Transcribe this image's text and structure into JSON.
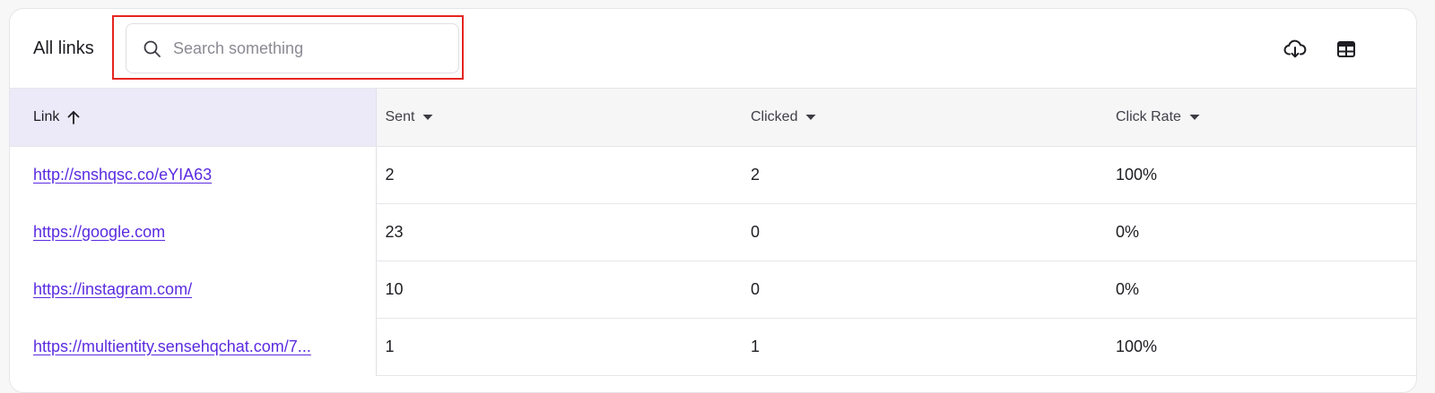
{
  "header": {
    "title": "All links",
    "search_placeholder": "Search something",
    "search_value": ""
  },
  "icons": {
    "search": "search-icon",
    "download": "cloud-download-icon",
    "columns": "table-columns-icon"
  },
  "colors": {
    "link": "#5a2be0",
    "sorted_header_bg": "#eceaf8",
    "highlight_border": "#e5251f"
  },
  "table": {
    "columns": [
      {
        "label": "Link",
        "sort": "ascending"
      },
      {
        "label": "Sent",
        "sort": "dropdown"
      },
      {
        "label": "Clicked",
        "sort": "dropdown"
      },
      {
        "label": "Click Rate",
        "sort": "dropdown"
      }
    ],
    "rows": [
      {
        "link": "http://snshqsc.co/eYIA63",
        "sent": "2",
        "clicked": "2",
        "rate": "100%"
      },
      {
        "link": "https://google.com",
        "sent": "23",
        "clicked": "0",
        "rate": "0%"
      },
      {
        "link": "https://instagram.com/",
        "sent": "10",
        "clicked": "0",
        "rate": "0%"
      },
      {
        "link": "https://multientity.sensehqchat.com/7...",
        "sent": "1",
        "clicked": "1",
        "rate": "100%"
      }
    ]
  }
}
